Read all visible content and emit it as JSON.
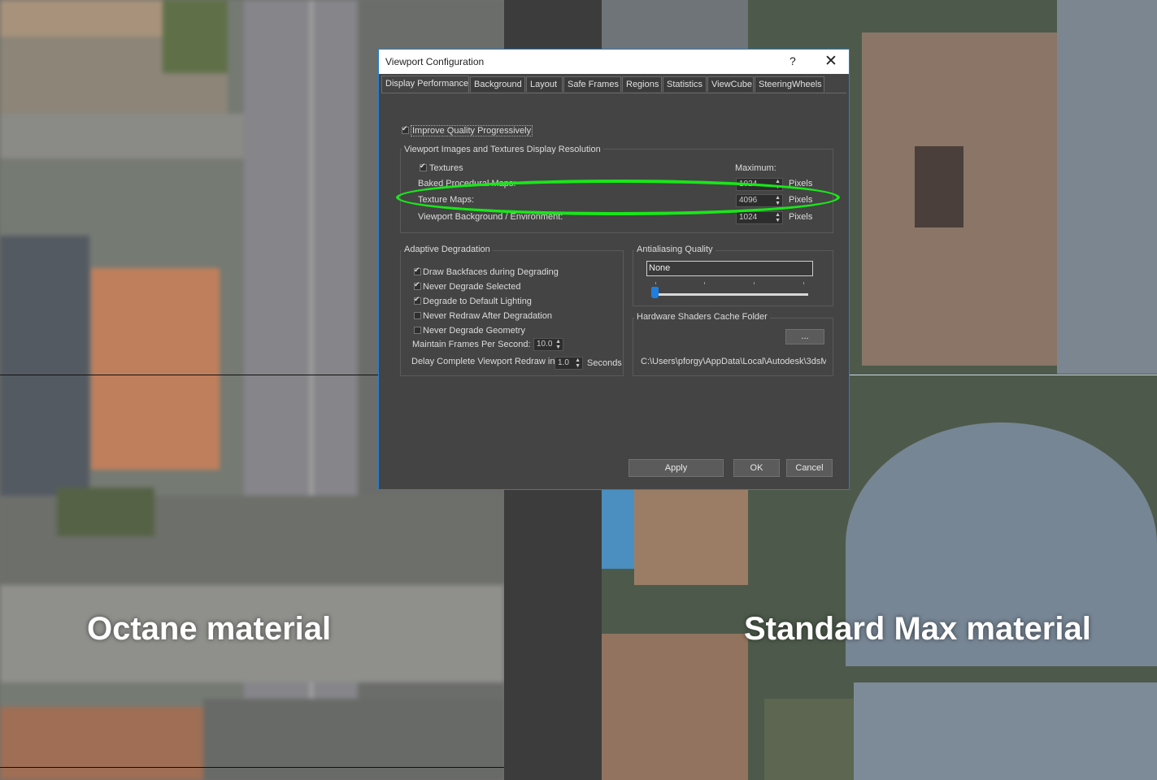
{
  "viewports": {
    "left_label": "Octane material",
    "right_label": "Standard Max material"
  },
  "dialog": {
    "title": "Viewport Configuration",
    "help": "?",
    "close": "✕",
    "tabs": [
      "Display Performance",
      "Background",
      "Layout",
      "Safe Frames",
      "Regions",
      "Statistics",
      "ViewCube",
      "SteeringWheels"
    ],
    "active_tab": "Display Performance",
    "improve_quality": {
      "label": "Improve Quality Progressively",
      "checked": true
    },
    "resolution_group": {
      "title": "Viewport Images and Textures Display Resolution",
      "textures": {
        "label": "Textures",
        "checked": true
      },
      "maximum_label": "Maximum:",
      "rows": [
        {
          "label": "Baked Procedural Maps:",
          "value": "1024",
          "unit": "Pixels"
        },
        {
          "label": "Texture Maps:",
          "value": "4096",
          "unit": "Pixels"
        },
        {
          "label": "Viewport Background / Environment:",
          "value": "1024",
          "unit": "Pixels"
        }
      ]
    },
    "adaptive_group": {
      "title": "Adaptive Degradation",
      "options": [
        {
          "label": "Draw Backfaces during Degrading",
          "checked": true
        },
        {
          "label": "Never Degrade Selected",
          "checked": true
        },
        {
          "label": "Degrade to Default Lighting",
          "checked": true
        },
        {
          "label": "Never Redraw After Degradation",
          "checked": false
        },
        {
          "label": "Never Degrade Geometry",
          "checked": false
        }
      ],
      "fps_label": "Maintain Frames Per Second:",
      "fps_value": "10.0",
      "delay_label": "Delay Complete Viewport Redraw in",
      "delay_value": "1.0",
      "delay_unit": "Seconds"
    },
    "antialiasing_group": {
      "title": "Antialiasing Quality",
      "value": "None"
    },
    "shader_group": {
      "title": "Hardware Shaders Cache Folder",
      "browse_label": "...",
      "path": "C:\\Users\\pforgy\\AppData\\Local\\Autodesk\\3dsM"
    },
    "buttons": {
      "apply": "Apply",
      "ok": "OK",
      "cancel": "Cancel"
    },
    "colors": {
      "accent": "#1f80d8",
      "highlight": "#19e619"
    }
  }
}
